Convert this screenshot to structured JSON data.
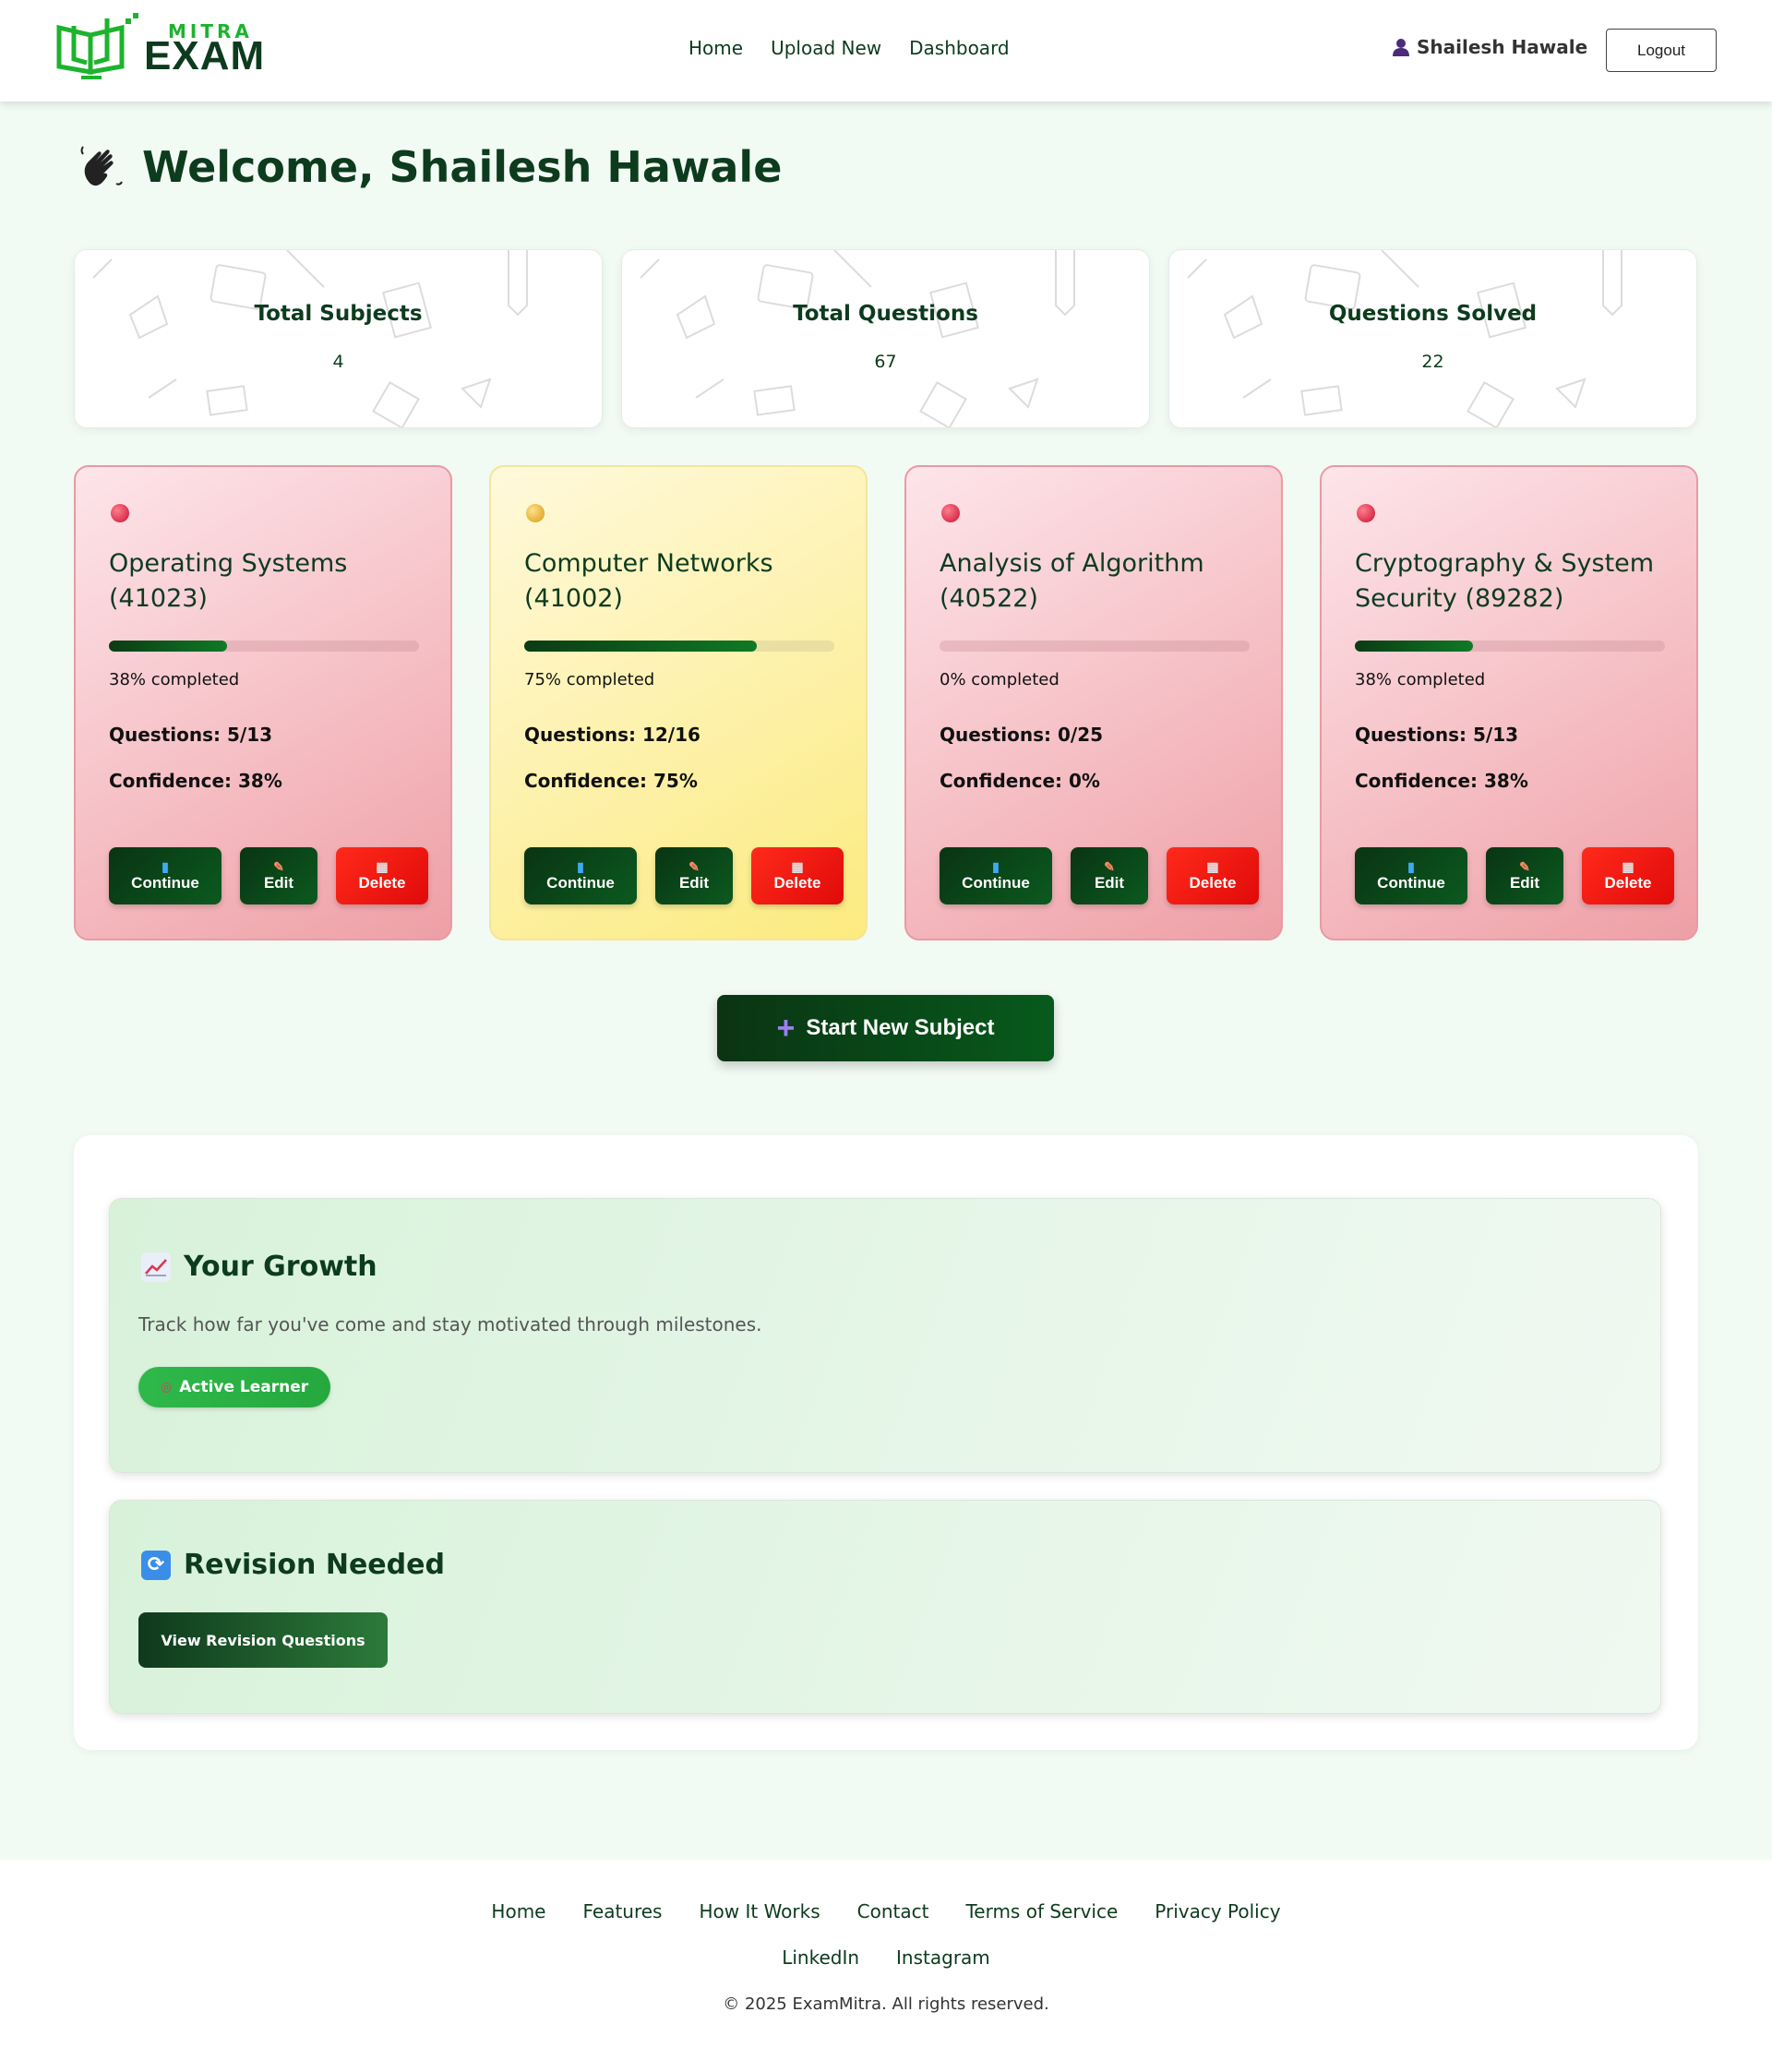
{
  "header": {
    "logo_top": "MITRA",
    "logo_bottom": "EXAM",
    "nav": [
      "Home",
      "Upload New",
      "Dashboard"
    ],
    "user_name": "Shailesh Hawale",
    "logout_label": "Logout"
  },
  "welcome": {
    "title": "Welcome, Shailesh Hawale",
    "icon": "waving-hand-icon"
  },
  "stats": [
    {
      "label": "Total Subjects",
      "value": "4"
    },
    {
      "label": "Total Questions",
      "value": "67"
    },
    {
      "label": "Questions Solved",
      "value": "22"
    }
  ],
  "subjects": [
    {
      "title": "Operating Systems (41023)",
      "progress": 0.38,
      "progress_text": "38% completed",
      "questions": "Questions: 5/13",
      "confidence": "Confidence: 38%",
      "status_color": "red"
    },
    {
      "title": "Computer Networks (41002)",
      "progress": 0.75,
      "progress_text": "75% completed",
      "questions": "Questions: 12/16",
      "confidence": "Confidence: 75%",
      "status_color": "yellow"
    },
    {
      "title": "Analysis of Algorithm (40522)",
      "progress": 0.0,
      "progress_text": "0% completed",
      "questions": "Questions: 0/25",
      "confidence": "Confidence: 0%",
      "status_color": "red"
    },
    {
      "title": "Cryptography & System Security (89282)",
      "progress": 0.38,
      "progress_text": "38% completed",
      "questions": "Questions: 5/13",
      "confidence": "Confidence: 38%",
      "status_color": "red"
    }
  ],
  "subject_buttons": {
    "continue_label": "Continue",
    "continue_icon": "book-icon",
    "edit_label": "Edit",
    "edit_icon": "pencil-icon",
    "delete_label": "Delete",
    "delete_icon": "trash-icon"
  },
  "start_button": {
    "label": "Start New Subject",
    "icon": "plus-icon"
  },
  "growth": {
    "title": "Your Growth",
    "icon": "chart-increasing-icon",
    "description": "Track how far you've come and stay motivated through milestones.",
    "badge": "Active Learner",
    "badge_icon": "target-icon"
  },
  "revision": {
    "title": "Revision Needed",
    "icon": "repeat-icon",
    "button_label": "View Revision Questions"
  },
  "footer": {
    "links_row1": [
      "Home",
      "Features",
      "How It Works",
      "Contact",
      "Terms of Service",
      "Privacy Policy"
    ],
    "links_row2": [
      "LinkedIn",
      "Instagram"
    ],
    "copyright": "© 2025 ExamMitra. All rights reserved."
  },
  "colors": {
    "brand_dark": "#0d3b1e",
    "brand_green": "#1db32e",
    "danger": "#e00a0a",
    "card_red": "#f6c3c8",
    "card_yellow": "#fdf1a9",
    "page_bg": "#f2faf4"
  }
}
